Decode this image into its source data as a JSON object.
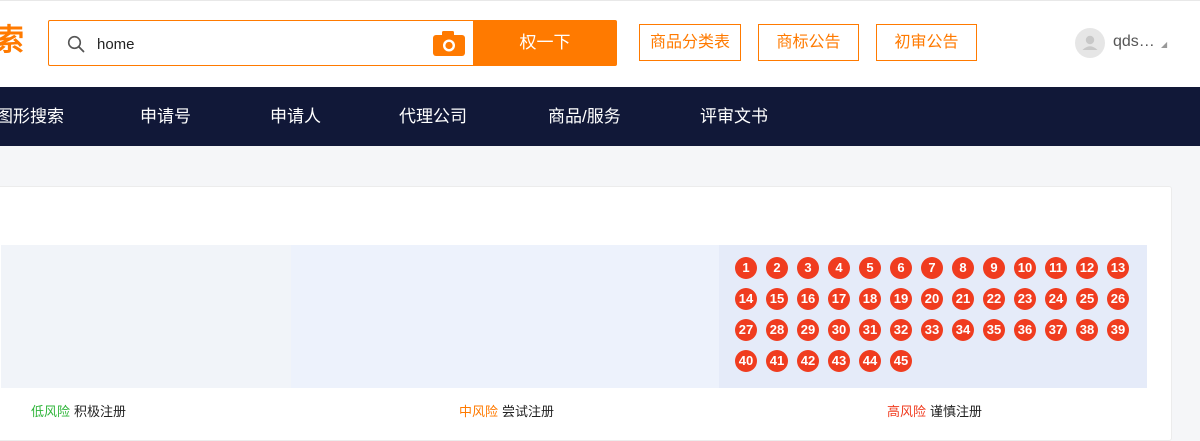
{
  "header": {
    "logo_fragment": "索",
    "search": {
      "value": "home",
      "placeholder": ""
    },
    "search_button_label": "权一下",
    "links": [
      "商品分类表",
      "商标公告",
      "初审公告"
    ],
    "user_name": "qds…"
  },
  "nav": {
    "items": [
      "图形搜索",
      "申请号",
      "申请人",
      "代理公司",
      "商品/服务",
      "评审文书"
    ]
  },
  "risk": {
    "low": {
      "level": "低风险",
      "action": "积极注册"
    },
    "mid": {
      "level": "中风险",
      "action": "尝试注册"
    },
    "high": {
      "level": "高风险",
      "action": "谨慎注册"
    }
  },
  "class_numbers": [
    "1",
    "2",
    "3",
    "4",
    "5",
    "6",
    "7",
    "8",
    "9",
    "10",
    "11",
    "12",
    "13",
    "14",
    "15",
    "16",
    "17",
    "18",
    "19",
    "20",
    "21",
    "22",
    "23",
    "24",
    "25",
    "26",
    "27",
    "28",
    "29",
    "30",
    "31",
    "32",
    "33",
    "34",
    "35",
    "36",
    "37",
    "38",
    "39",
    "40",
    "41",
    "42",
    "43",
    "44",
    "45"
  ],
  "colors": {
    "accent": "#ff7a00",
    "nav_bg": "#111838",
    "dot": "#f03c1f",
    "low": "#2fb53a",
    "mid": "#ff7a00",
    "high": "#f03c1f"
  }
}
